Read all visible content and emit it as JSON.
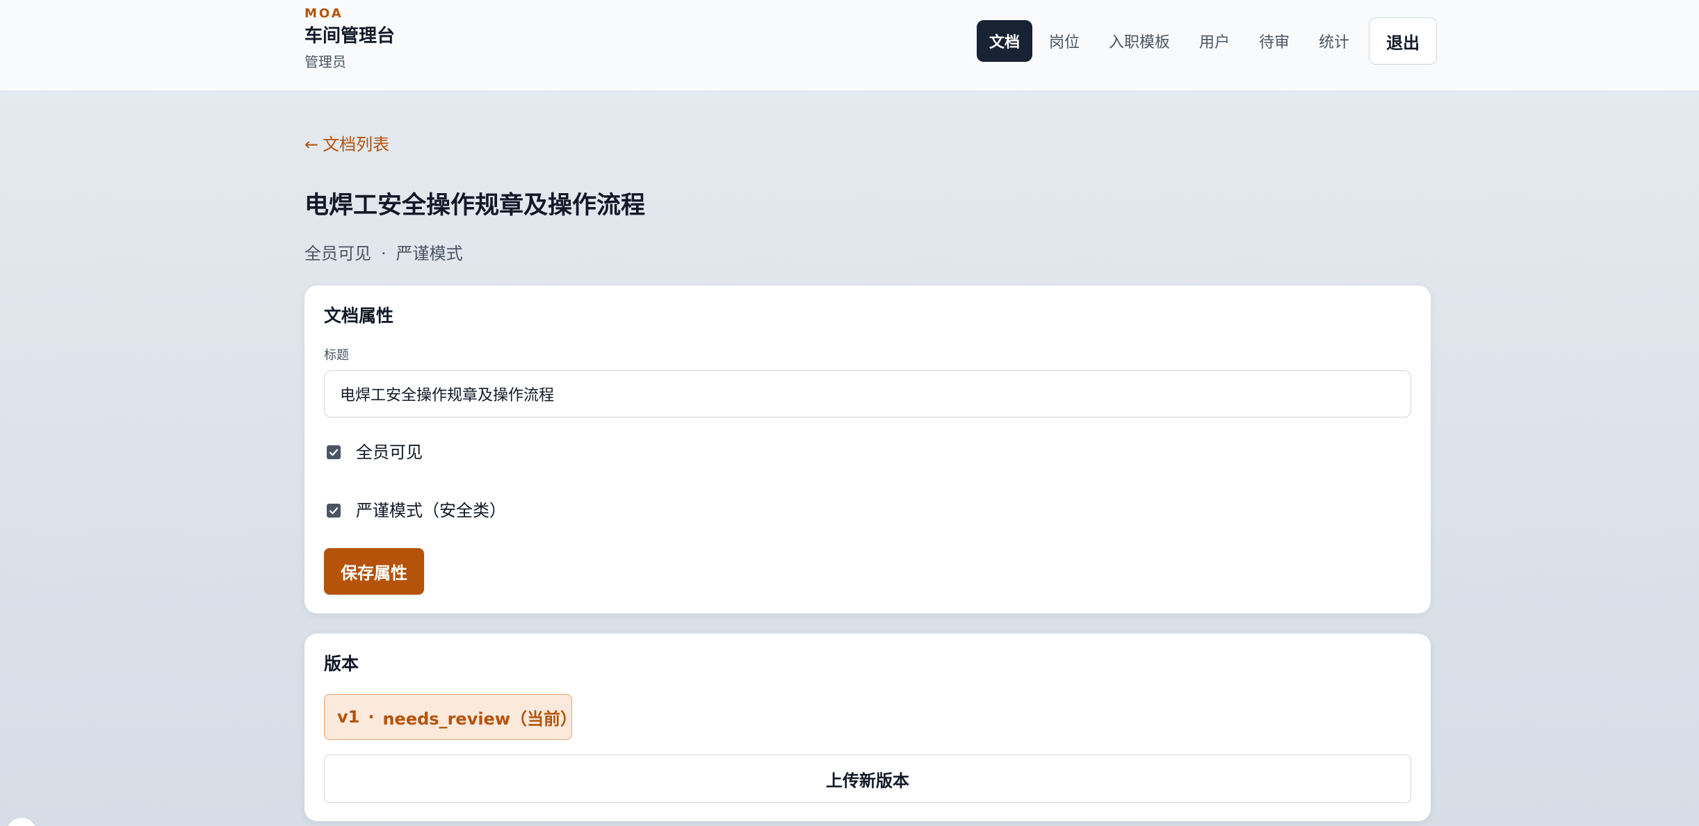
{
  "header": {
    "brand_tag": "MOA",
    "app_title": "车间管理台",
    "role": "管理员",
    "nav": [
      {
        "label": "文档",
        "active": true
      },
      {
        "label": "岗位",
        "active": false
      },
      {
        "label": "入职模板",
        "active": false
      },
      {
        "label": "用户",
        "active": false
      },
      {
        "label": "待审",
        "active": false
      },
      {
        "label": "统计",
        "active": false
      }
    ],
    "logout_label": "退出"
  },
  "page": {
    "back_arrow": "←",
    "back_label": "文档列表",
    "title": "电焊工安全操作规章及操作流程",
    "meta_visibility": "全员可见",
    "meta_separator": "·",
    "meta_mode": "严谨模式"
  },
  "properties": {
    "heading": "文档属性",
    "title_label": "标题",
    "title_value": "电焊工安全操作规章及操作流程",
    "checkboxes": [
      {
        "label": "全员可见",
        "checked": true
      },
      {
        "label": "严谨模式（安全类）",
        "checked": true
      }
    ],
    "save_label": "保存属性"
  },
  "versions": {
    "heading": "版本",
    "current": {
      "version": "v1",
      "separator": "·",
      "status": "needs_review（当前）"
    },
    "upload_label": "上传新版本"
  },
  "colors": {
    "accent": "#b45309",
    "nav_active_bg": "#172233",
    "pill_bg": "#fbe9dc",
    "pill_border": "#e8a06c"
  }
}
